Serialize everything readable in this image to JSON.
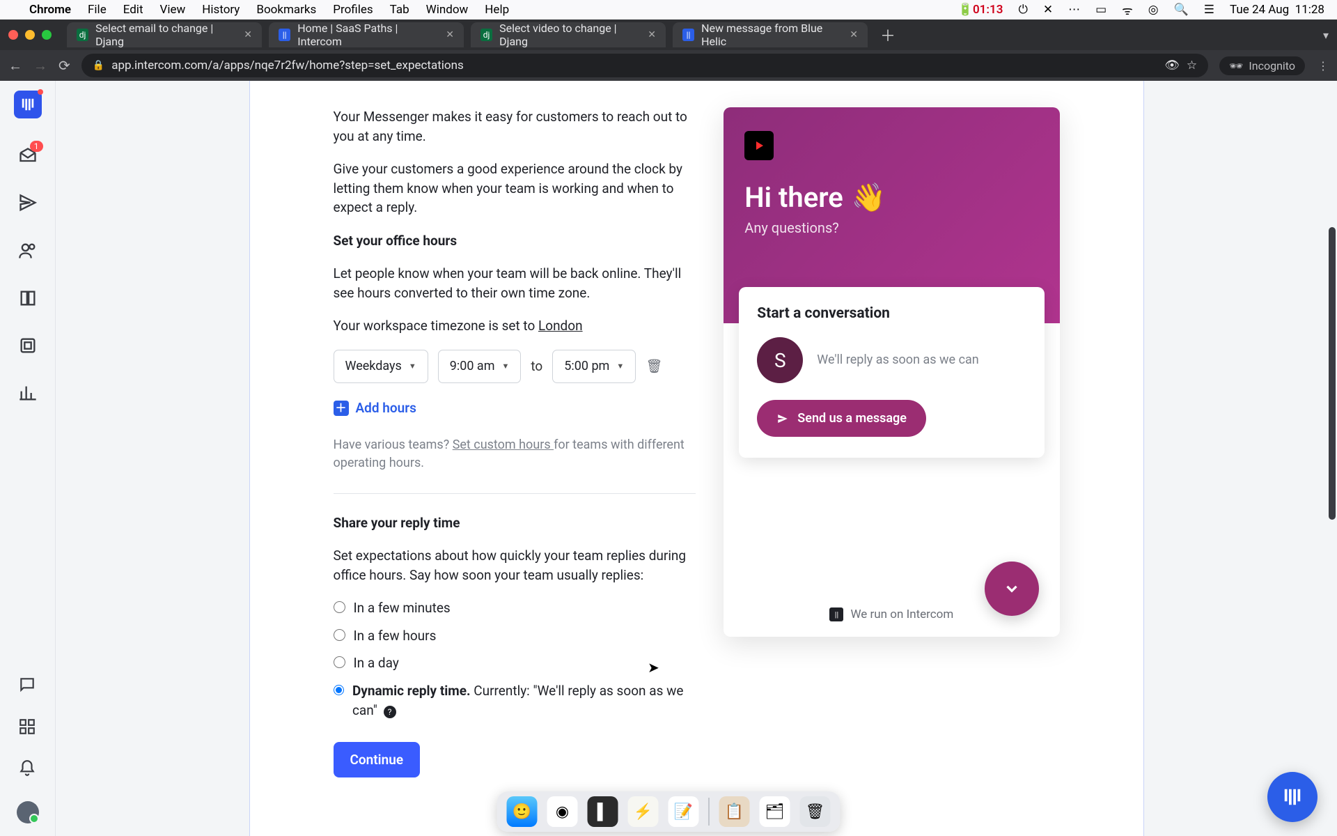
{
  "menubar": {
    "app": "Chrome",
    "items": [
      "File",
      "Edit",
      "View",
      "History",
      "Bookmarks",
      "Profiles",
      "Tab",
      "Window",
      "Help"
    ],
    "battery_time": "01:13",
    "date": "Tue 24 Aug",
    "time": "11:28"
  },
  "tabs": [
    {
      "title": "Select email to change | Djang",
      "favicon_bg": "#0a6e3f"
    },
    {
      "title": "Home | SaaS Paths | Intercom",
      "favicon_bg": "#2b5ee8",
      "active": true
    },
    {
      "title": "Select video to change | Djang",
      "favicon_bg": "#0a6e3f"
    },
    {
      "title": "New message from Blue Helic",
      "favicon_bg": "#2b5ee8"
    }
  ],
  "address": {
    "url": "app.intercom.com/a/apps/nqe7r2fw/home?step=set_expectations",
    "incognito_label": "Incognito"
  },
  "content": {
    "intro1": "Your Messenger makes it easy for customers to reach out to you at any time.",
    "intro2": "Give your customers a good experience around the clock by letting them know when your team is working and when to expect a reply.",
    "office_heading": "Set your office hours",
    "office_desc": "Let people know when your team will be back online. They'll see hours converted to their own time zone.",
    "tz_prefix": "Your workspace timezone is set to ",
    "tz_link": "London",
    "days_dd": "Weekdays",
    "start_dd": "9:00 am",
    "to_label": "to",
    "end_dd": "5:00 pm",
    "add_hours": "Add hours",
    "teams_prefix": "Have various teams? ",
    "teams_link": "Set custom hours ",
    "teams_suffix": "for teams with different operating hours.",
    "reply_heading": "Share your reply time",
    "reply_desc": "Set expectations about how quickly your team replies during office hours. Say how soon your team usually replies:",
    "radio1": "In a few minutes",
    "radio2": "In a few hours",
    "radio3": "In a day",
    "radio4_bold": "Dynamic reply time.",
    "radio4_rest": " Currently: \"We'll reply as soon as we can\"",
    "continue": "Continue"
  },
  "preview": {
    "hello": "Hi there",
    "wave": "👋",
    "sub": "Any questions?",
    "card_h": "Start a conversation",
    "avatar_letter": "S",
    "reply_text": "We'll reply as soon as we can",
    "send_btn": "Send us a message",
    "footer": "We run on Intercom"
  },
  "rail_badge": "1"
}
